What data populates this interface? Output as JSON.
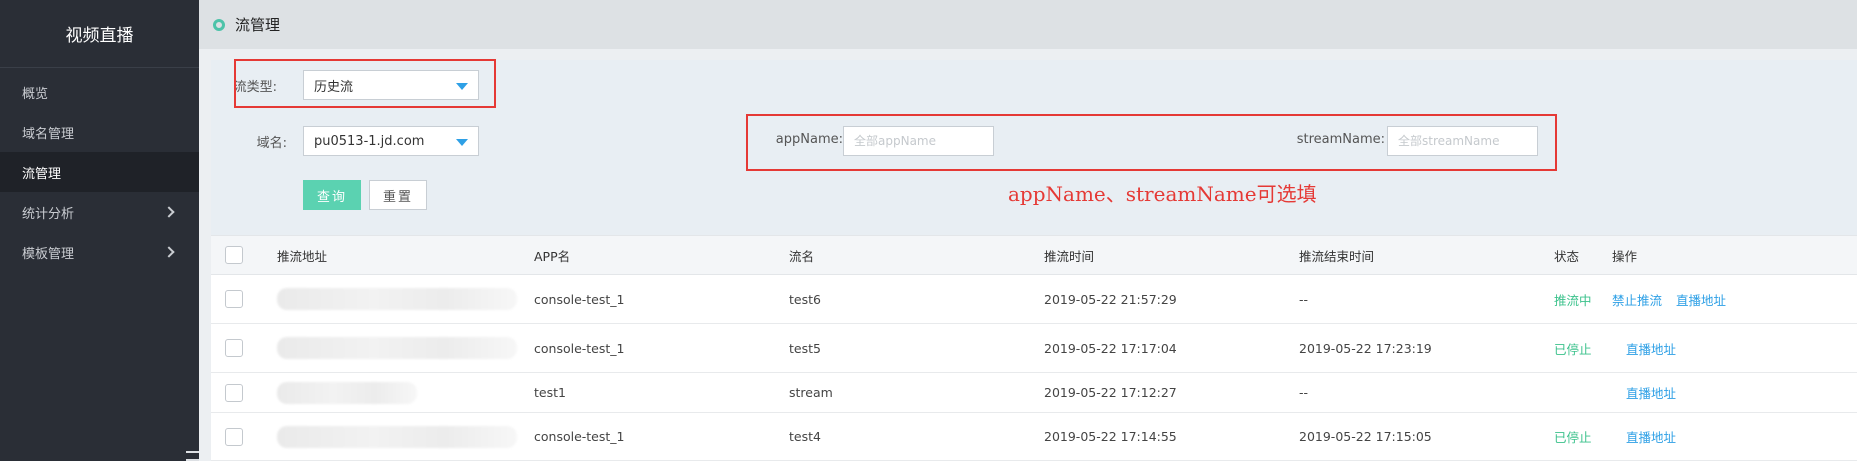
{
  "sidebar": {
    "brand": "视频直播",
    "items": [
      {
        "label": "概览"
      },
      {
        "label": "域名管理"
      },
      {
        "label": "流管理"
      },
      {
        "label": "统计分析"
      },
      {
        "label": "模板管理"
      }
    ]
  },
  "header": {
    "title": "流管理"
  },
  "filters": {
    "stream_type_label": "流类型:",
    "stream_type_value": "历史流",
    "domain_label": "域名:",
    "domain_value": "pu0513-1.jd.com",
    "app_name_label": "appName:",
    "app_name_placeholder": "全部appName",
    "stream_name_label": "streamName:",
    "stream_name_placeholder": "全部streamName",
    "query_button": "查询",
    "reset_button": "重置"
  },
  "annotation": "appName、streamName可选填",
  "table": {
    "columns": [
      "推流地址",
      "APP名",
      "流名",
      "推流时间",
      "推流结束时间",
      "状态",
      "操作"
    ],
    "rows": [
      {
        "app": "console-test_1",
        "stream": "test6",
        "start": "2019-05-22 21:57:29",
        "end": "--",
        "status": "推流中",
        "actions": [
          "禁止推流",
          "直播地址"
        ]
      },
      {
        "app": "console-test_1",
        "stream": "test5",
        "start": "2019-05-22 17:17:04",
        "end": "2019-05-22 17:23:19",
        "status": "已停止",
        "actions": [
          "直播地址"
        ]
      },
      {
        "app": "test1",
        "stream": "stream",
        "start": "2019-05-22 17:12:27",
        "end": "--",
        "status": "",
        "actions": [
          "直播地址"
        ]
      },
      {
        "app": "console-test_1",
        "stream": "test4",
        "start": "2019-05-22 17:14:55",
        "end": "2019-05-22 17:15:05",
        "status": "已停止",
        "actions": [
          "直播地址"
        ]
      }
    ]
  },
  "colors": {
    "sidebar_bg": "#2a2e36",
    "accent": "#5bd2b1",
    "link": "#2ea0e6",
    "status_green": "#3cc28c",
    "annotation_red": "#e53935"
  }
}
